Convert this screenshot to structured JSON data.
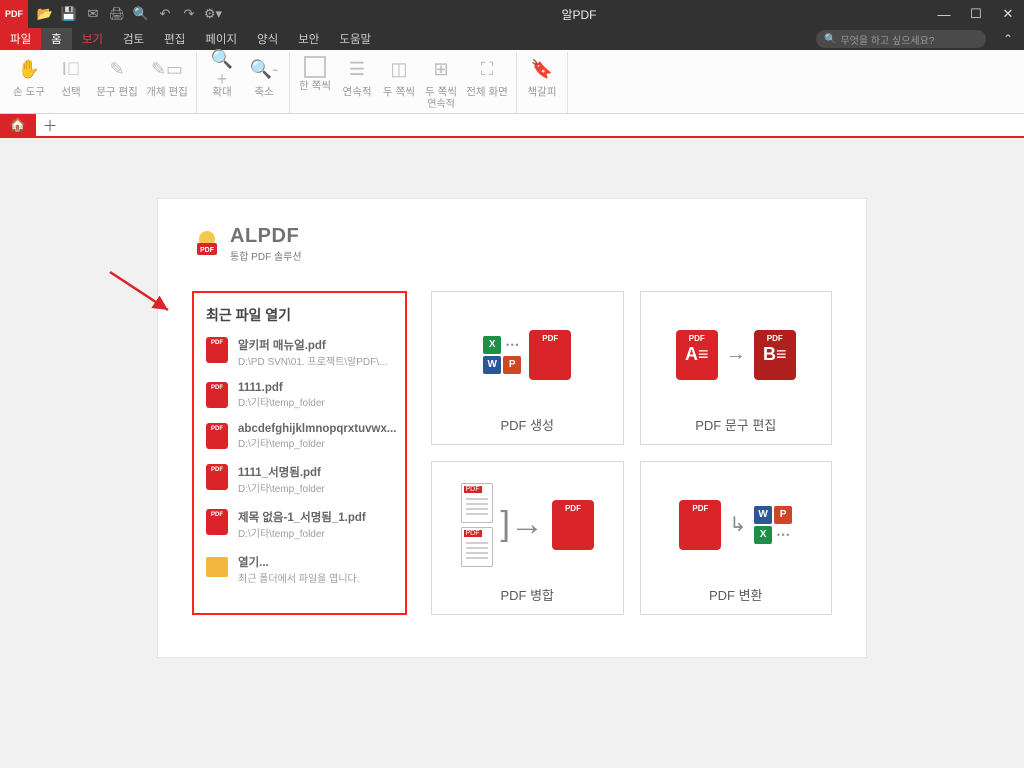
{
  "app": {
    "title": "알PDF",
    "icon_label": "PDF"
  },
  "menubar": {
    "items": [
      "파일",
      "홈",
      "보기",
      "검토",
      "편집",
      "페이지",
      "양식",
      "보안",
      "도움말"
    ],
    "search_placeholder": "무엇을 하고 싶으세요?"
  },
  "ribbon": {
    "tools": [
      {
        "label": "손 도구"
      },
      {
        "label": "선택"
      },
      {
        "label": "문구 편집"
      },
      {
        "label": "개체 편집"
      }
    ],
    "zoom": [
      {
        "label": "확대"
      },
      {
        "label": "축소"
      }
    ],
    "page_layout": [
      {
        "label": "한 쪽씩"
      },
      {
        "label": "연속적"
      },
      {
        "label": "두 쪽씩"
      },
      {
        "label": "두 쪽씩",
        "sub": "연속적"
      },
      {
        "label": "전체 화면"
      }
    ],
    "bookmark": {
      "label": "책갈피"
    }
  },
  "brand": {
    "name": "ALPDF",
    "tagline": "통합 PDF 솔루션"
  },
  "recent": {
    "title": "최근 파일 열기",
    "files": [
      {
        "name": "알키퍼 매뉴얼.pdf",
        "path": "D:\\PD SVN\\01. 프로젝트\\알PDF\\..."
      },
      {
        "name": "1111.pdf",
        "path": "D:\\기타\\temp_folder"
      },
      {
        "name": "abcdefghijklmnopqrxtuvwx...",
        "path": "D:\\기타\\temp_folder"
      },
      {
        "name": "1111_서명됨.pdf",
        "path": "D:\\기타\\temp_folder"
      },
      {
        "name": "제목 없음-1_서명됨_1.pdf",
        "path": "D:\\기타\\temp_folder"
      }
    ],
    "open": {
      "label": "열기...",
      "hint": "최근 폴더에서 파일을 엽니다."
    }
  },
  "tiles": {
    "create": "PDF 생성",
    "edit_text": "PDF 문구 편집",
    "merge": "PDF 병합",
    "convert": "PDF 변환"
  }
}
